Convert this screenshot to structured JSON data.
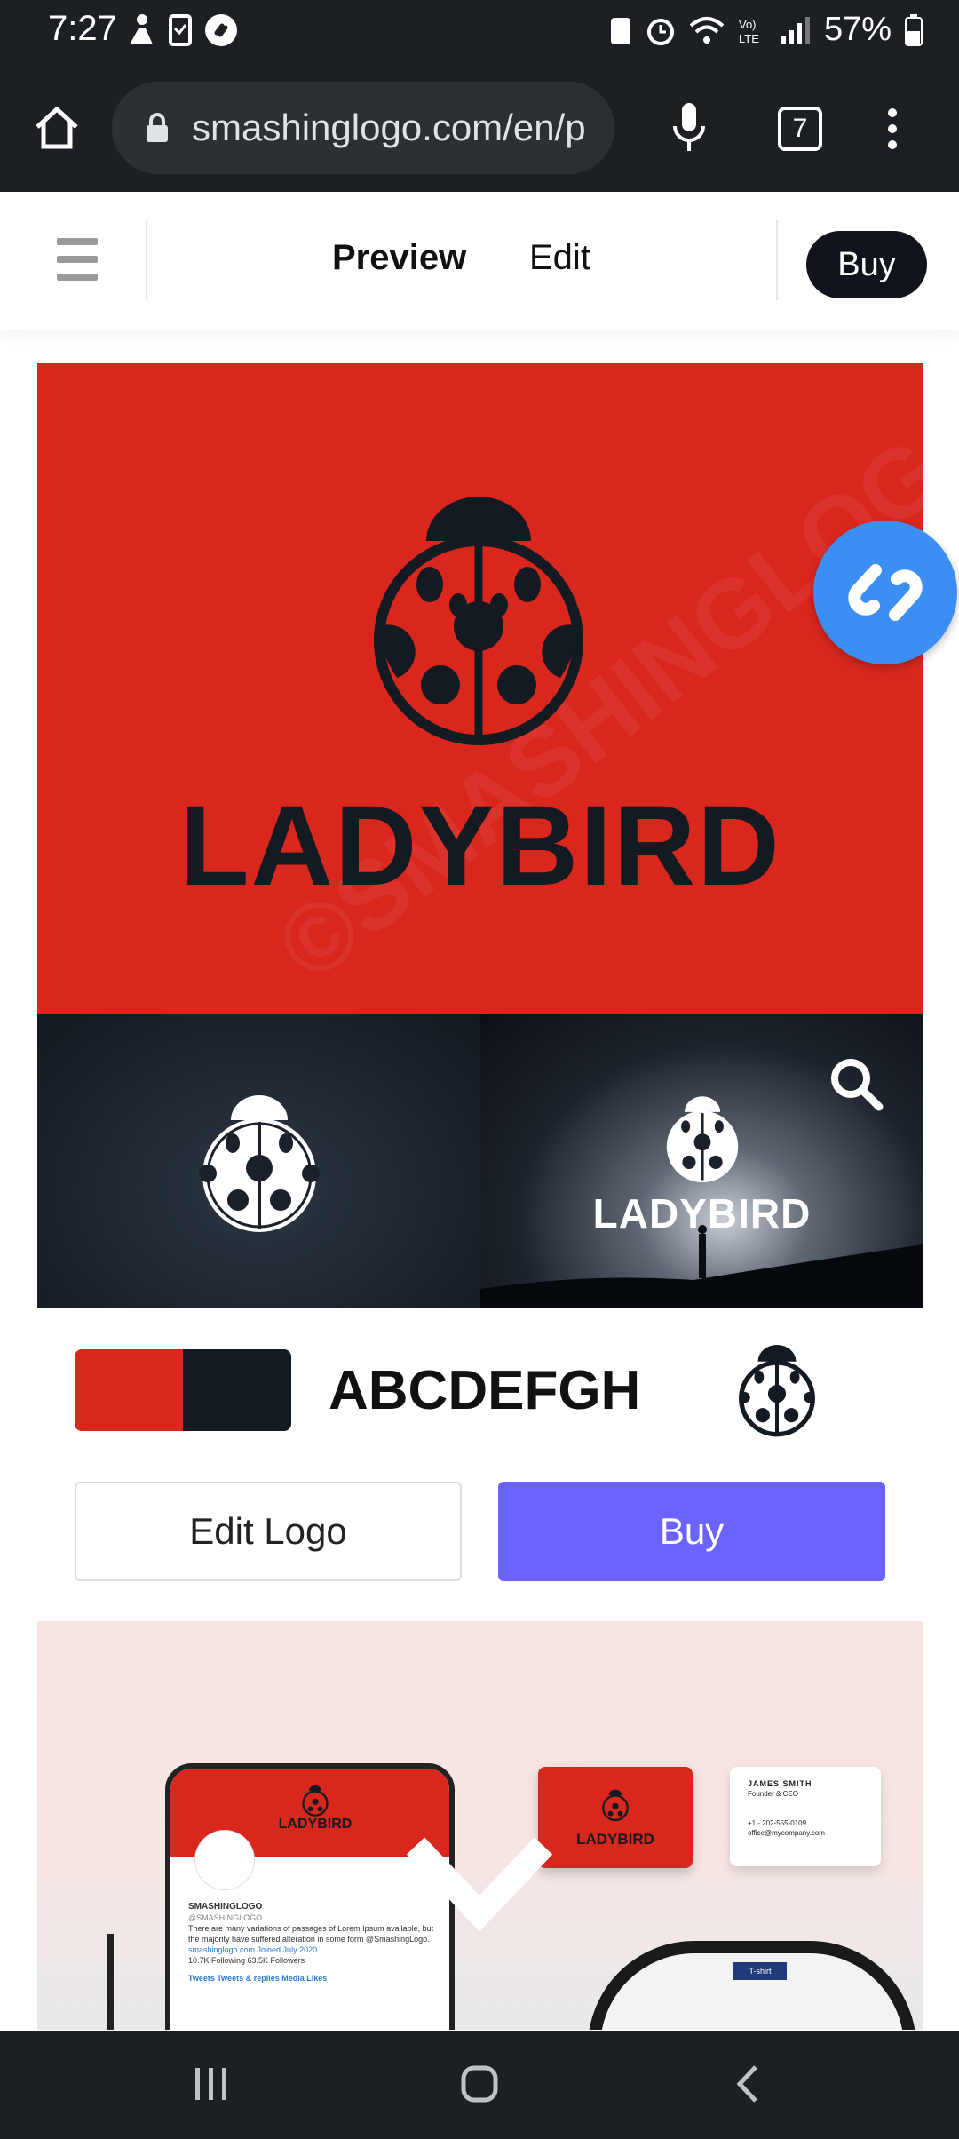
{
  "status_bar": {
    "time": "7:27",
    "battery": "57%"
  },
  "browser": {
    "url": "smashinglogo.com/en/p",
    "tab_count": "7"
  },
  "header": {
    "tab_preview": "Preview",
    "tab_edit": "Edit",
    "buy_label": "Buy"
  },
  "hero": {
    "brand_name": "LADYBIRD",
    "watermark": "©SMASHINGLOGO"
  },
  "thumbs": {
    "right_brand": "LADYBIRD"
  },
  "style_row": {
    "font_sample": "ABCDEFGH",
    "colors": [
      "#d9271e",
      "#141a22"
    ]
  },
  "actions": {
    "edit_label": "Edit Logo",
    "buy_label": "Buy"
  },
  "mockups": {
    "phone_brand": "LADYBIRD",
    "phone_account": "SMASHINGLOGO",
    "phone_handle": "@SMASHINGLOGO",
    "phone_bio": "There are many variations of passages of Lorem Ipsum available, but the majority have suffered alteration in some form @SmashingLogo.",
    "phone_meta": "smashinglogo.com  Joined July 2020",
    "phone_stats": "10.7K Following  63.5K Followers",
    "phone_tabs": "Tweets   Tweets & replies   Media   Likes",
    "card_red_brand": "LADYBIRD",
    "card_name": "JAMES SMITH",
    "card_title": "Founder & CEO",
    "card_phone": "+1 - 202-555-0109",
    "card_email": "office@mycompany.com",
    "shirt_tag": "T-shirt"
  },
  "accent_colors": {
    "brand_red": "#d9271e",
    "brand_dark": "#141a22",
    "buy_purple": "#6c63ff",
    "shazam_blue": "#3b8ff2"
  }
}
